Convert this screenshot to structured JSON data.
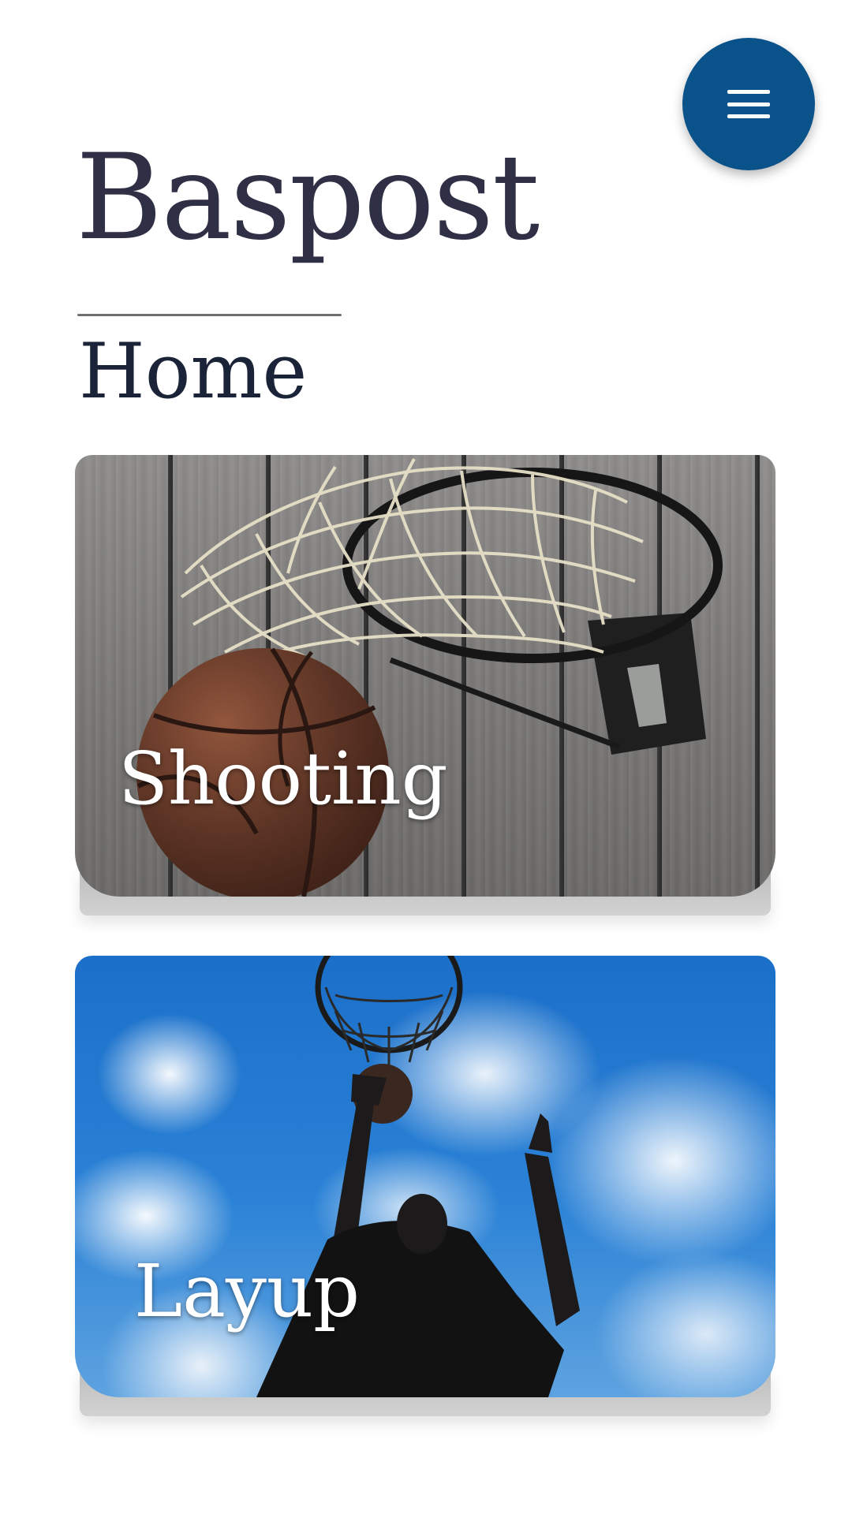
{
  "header": {
    "site_title": "Baspost",
    "page_title": "Home"
  },
  "menu": {
    "icon": "hamburger-menu-icon",
    "color": "#0a528a"
  },
  "cards": [
    {
      "label": "Shooting",
      "image": "basketball-net-on-wooden-backboard"
    },
    {
      "label": "Layup",
      "image": "player-dunking-against-blue-sky"
    }
  ],
  "colors": {
    "title": "#2f2f45",
    "accent": "#0a528a"
  }
}
